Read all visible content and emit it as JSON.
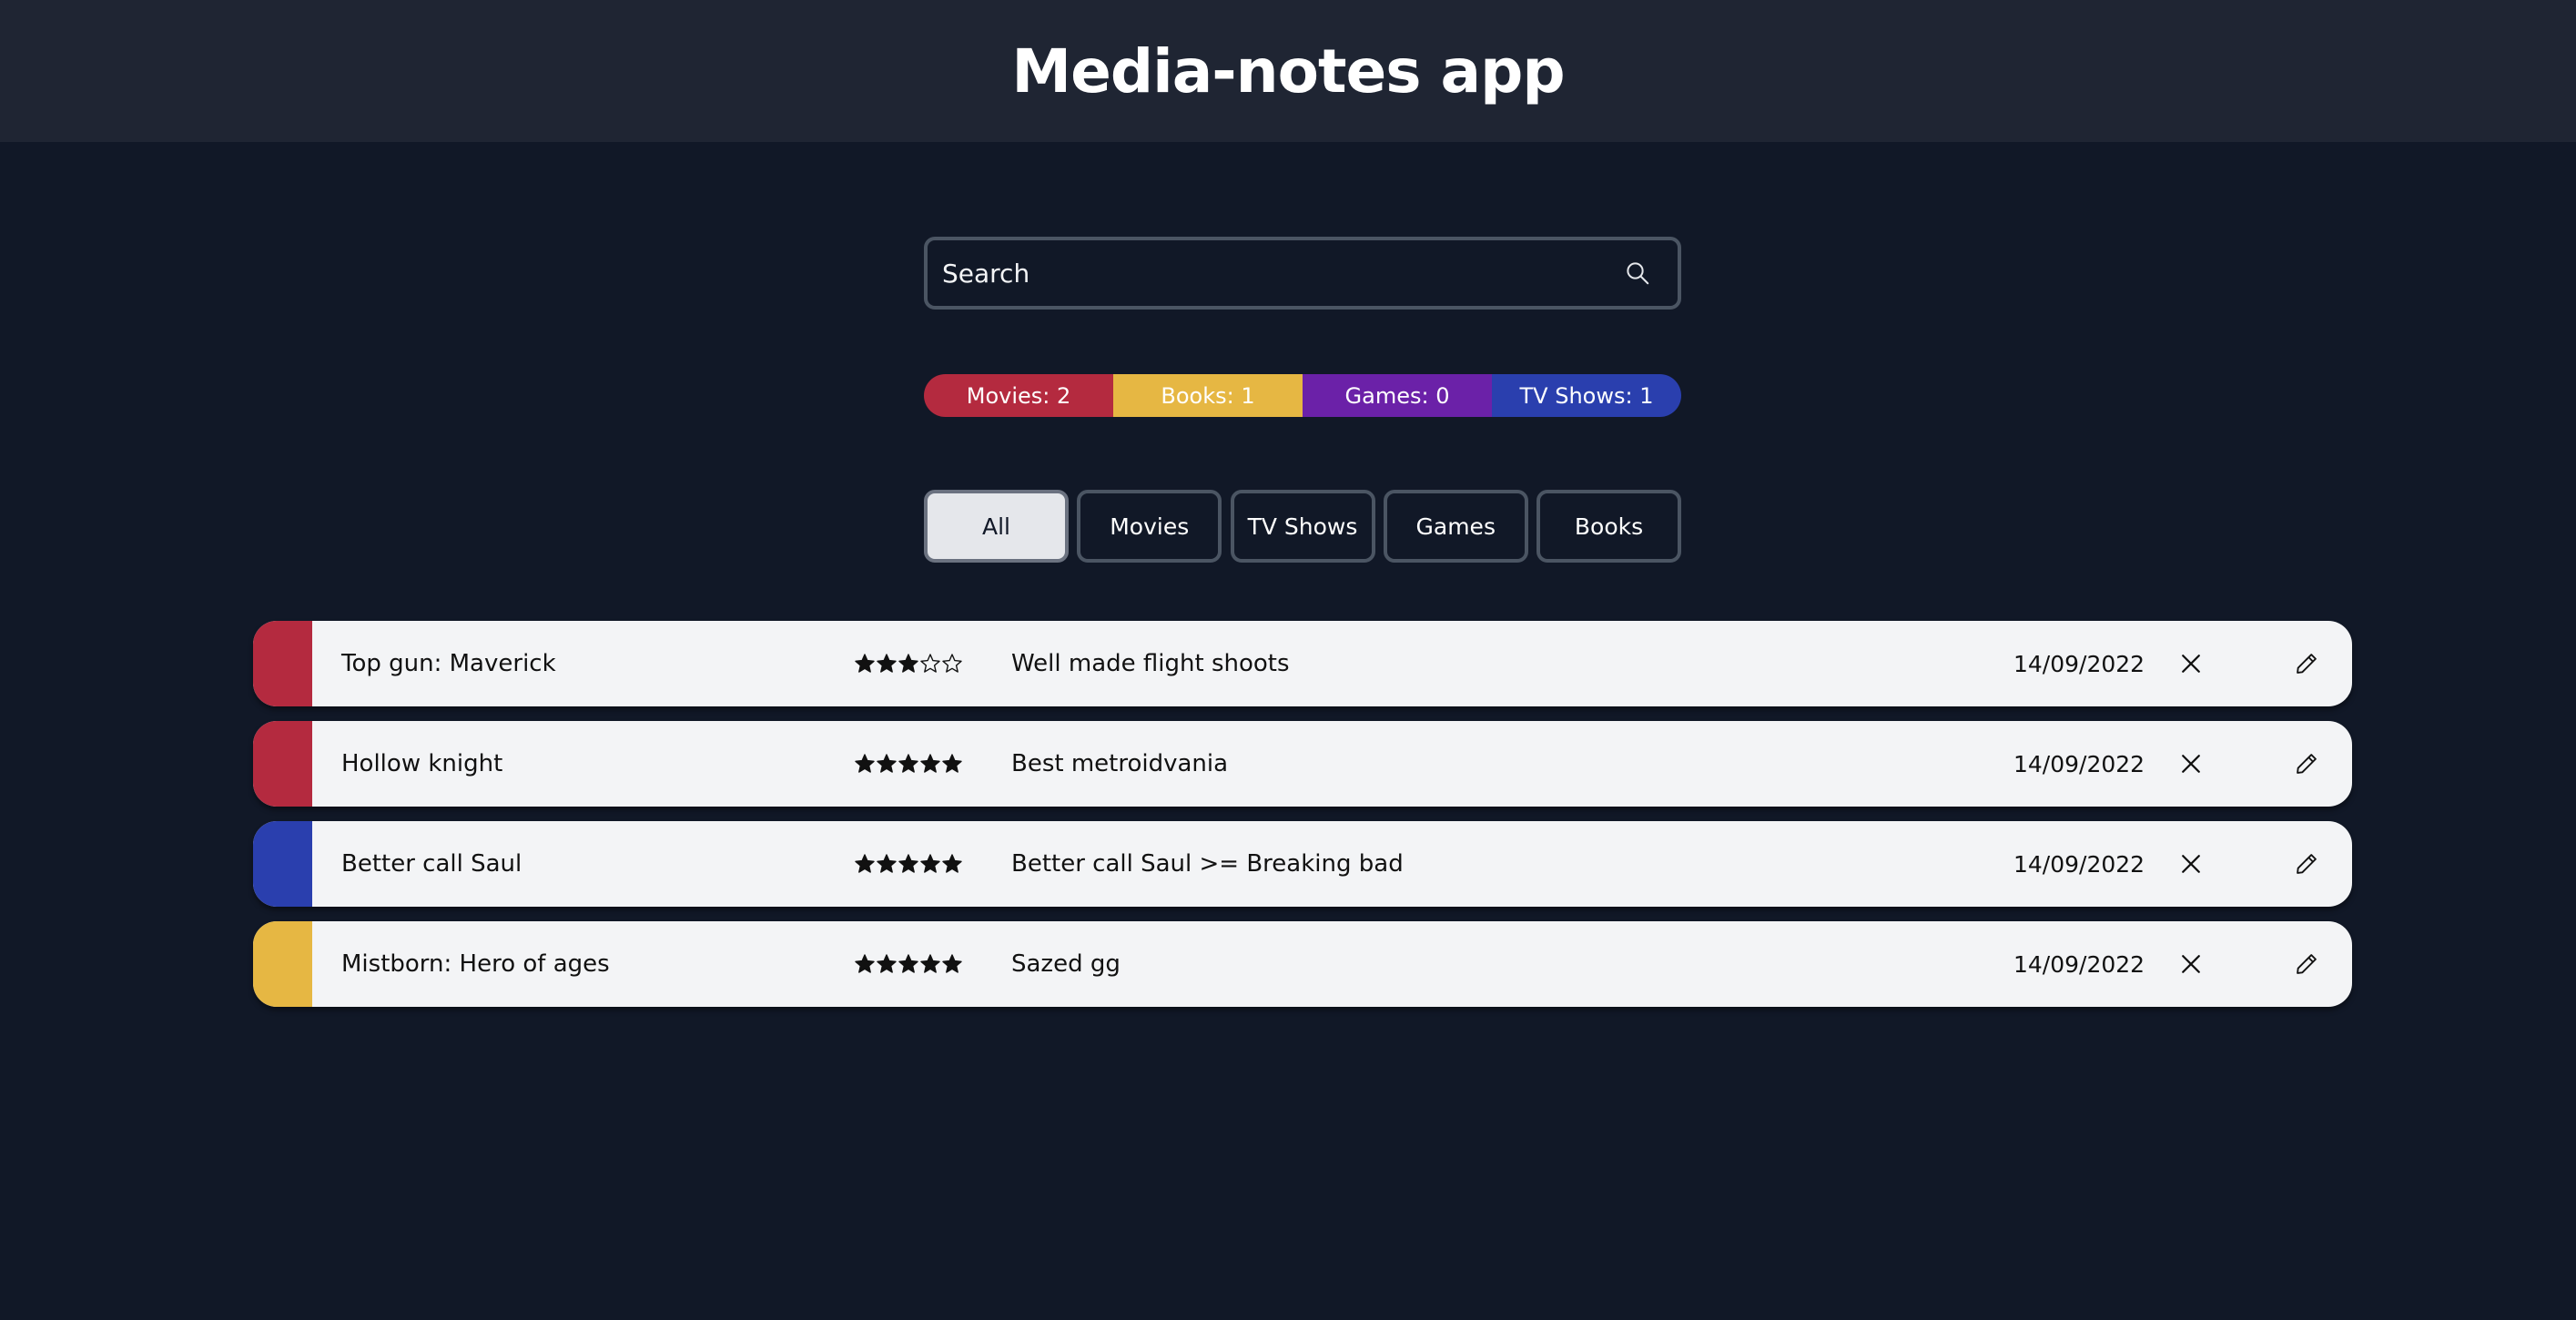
{
  "app": {
    "title": "Media-notes app"
  },
  "search": {
    "placeholder": "Search"
  },
  "counts": [
    {
      "label": "Movies: 2",
      "color": "#b42a3f"
    },
    {
      "label": "Books: 1",
      "color": "#e6b743"
    },
    {
      "label": "Games: 0",
      "color": "#6b21a8"
    },
    {
      "label": "TV Shows: 1",
      "color": "#2a3fae"
    }
  ],
  "filters": [
    {
      "label": "All",
      "active": true
    },
    {
      "label": "Movies",
      "active": false
    },
    {
      "label": "TV Shows",
      "active": false
    },
    {
      "label": "Games",
      "active": false
    },
    {
      "label": "Books",
      "active": false
    }
  ],
  "entries": [
    {
      "title": "Top gun: Maverick",
      "rating": 3,
      "max_rating": 5,
      "note": "Well made flight shoots",
      "date": "14/09/2022",
      "color": "#b42a3f"
    },
    {
      "title": "Hollow knight",
      "rating": 5,
      "max_rating": 5,
      "note": "Best metroidvania",
      "date": "14/09/2022",
      "color": "#b42a3f"
    },
    {
      "title": "Better call Saul",
      "rating": 5,
      "max_rating": 5,
      "note": "Better call Saul >= Breaking bad",
      "date": "14/09/2022",
      "color": "#2a3fae"
    },
    {
      "title": "Mistborn: Hero of ages",
      "rating": 5,
      "max_rating": 5,
      "note": "Sazed gg",
      "date": "14/09/2022",
      "color": "#e6b743"
    }
  ],
  "icons": {
    "search": "search-icon",
    "delete": "close-icon",
    "edit": "pencil-icon",
    "star_filled": "star-filled-icon",
    "star_empty": "star-outline-icon"
  }
}
